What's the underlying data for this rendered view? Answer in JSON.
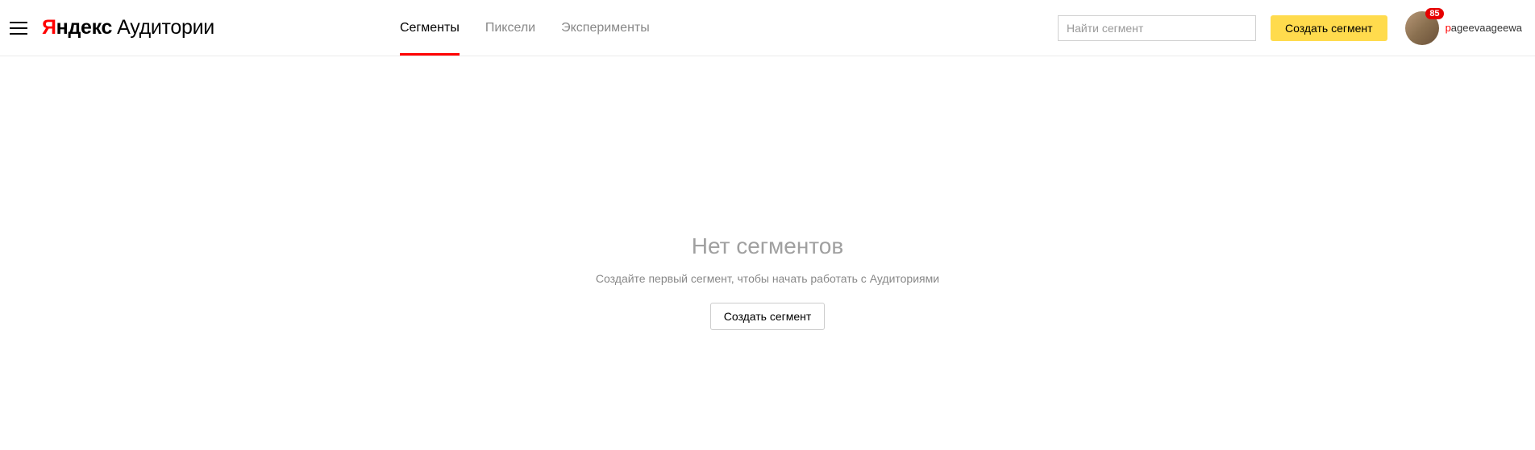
{
  "header": {
    "logo": {
      "ya": "Я",
      "ndex": "ндекс",
      "aud": "Аудитории"
    },
    "tabs": [
      {
        "label": "Сегменты",
        "active": true
      },
      {
        "label": "Пиксели",
        "active": false
      },
      {
        "label": "Эксперименты",
        "active": false
      }
    ],
    "search_placeholder": "Найти сегмент",
    "create_label": "Создать сегмент",
    "user": {
      "badge": "85",
      "name_first": "p",
      "name_rest": "ageevaageewa"
    }
  },
  "main": {
    "empty_title": "Нет сегментов",
    "empty_sub": "Создайте первый сегмент, чтобы начать работать с Аудиториями",
    "empty_button": "Создать сегмент"
  }
}
